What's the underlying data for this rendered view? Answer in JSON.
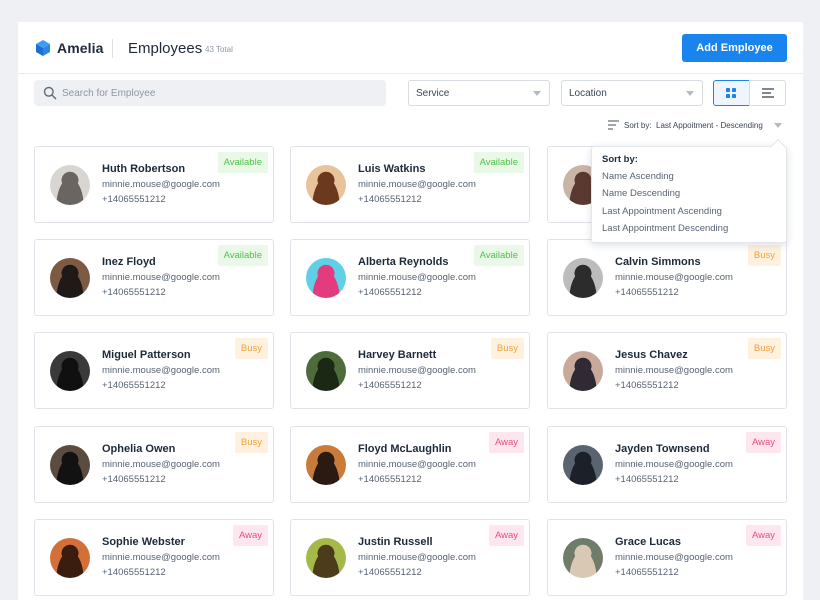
{
  "header": {
    "brand": "Amelia",
    "title": "Employees",
    "total": "43 Total",
    "add_button": "Add Employee"
  },
  "filters": {
    "search_placeholder": "Search for Employee",
    "service": "Service",
    "location": "Location"
  },
  "sort": {
    "label": "Sort by:",
    "current": "Last Appoitment - Descending",
    "menu_title": "Sort by:",
    "options": [
      "Name Ascending",
      "Name Descending",
      "Last Appointment Ascending",
      "Last Appointment Descending"
    ]
  },
  "colors": {
    "accent": "#1a84ee",
    "available_text": "#4fc24a",
    "available_bg": "#eaf8e7",
    "busy_text": "#f0a23c",
    "busy_bg": "#fff1de",
    "away_text": "#ee4d7b",
    "away_bg": "#fde6ee"
  },
  "icons": {
    "logo": "amelia-cube-logo",
    "search": "search-icon",
    "grid_view": "grid-view-icon",
    "list_view": "list-view-icon",
    "sort": "sort-lines-icon"
  },
  "employees": [
    {
      "name": "Huth Robertson",
      "email": "minnie.mouse@google.com",
      "phone": "+14065551212",
      "status": "Available"
    },
    {
      "name": "Luis Watkins",
      "email": "minnie.mouse@google.com",
      "phone": "+14065551212",
      "status": "Available"
    },
    {
      "name": "",
      "email": "",
      "phone": "",
      "status": ""
    },
    {
      "name": "Inez Floyd",
      "email": "minnie.mouse@google.com",
      "phone": "+14065551212",
      "status": "Available"
    },
    {
      "name": "Alberta Reynolds",
      "email": "minnie.mouse@google.com",
      "phone": "+14065551212",
      "status": "Available"
    },
    {
      "name": "Calvin Simmons",
      "email": "minnie.mouse@google.com",
      "phone": "+14065551212",
      "status": "Busy"
    },
    {
      "name": "Miguel Patterson",
      "email": "minnie.mouse@google.com",
      "phone": "+14065551212",
      "status": "Busy"
    },
    {
      "name": "Harvey Barnett",
      "email": "minnie.mouse@google.com",
      "phone": "+14065551212",
      "status": "Busy"
    },
    {
      "name": "Jesus Chavez",
      "email": "minnie.mouse@google.com",
      "phone": "+14065551212",
      "status": "Busy"
    },
    {
      "name": "Ophelia Owen",
      "email": "minnie.mouse@google.com",
      "phone": "+14065551212",
      "status": "Busy"
    },
    {
      "name": "Floyd McLaughlin",
      "email": "minnie.mouse@google.com",
      "phone": "+14065551212",
      "status": "Away"
    },
    {
      "name": "Jayden Townsend",
      "email": "minnie.mouse@google.com",
      "phone": "+14065551212",
      "status": "Away"
    },
    {
      "name": "Sophie Webster",
      "email": "minnie.mouse@google.com",
      "phone": "+14065551212",
      "status": "Away"
    },
    {
      "name": "Justin Russell",
      "email": "minnie.mouse@google.com",
      "phone": "+14065551212",
      "status": "Away"
    },
    {
      "name": "Grace Lucas",
      "email": "minnie.mouse@google.com",
      "phone": "+14065551212",
      "status": "Away"
    }
  ]
}
